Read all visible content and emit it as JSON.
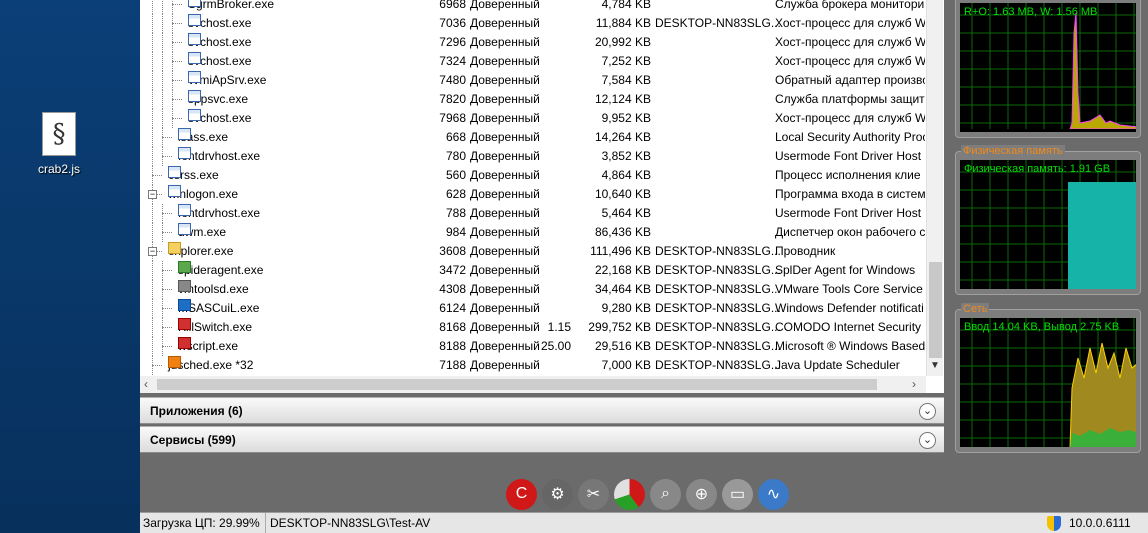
{
  "desktop": {
    "icon_label": "crab2.js"
  },
  "processes": [
    {
      "name": "SgrmBroker.exe",
      "pid": "6968",
      "trust": "Доверенный",
      "cpu": "",
      "mem": "4,784 KB",
      "user": "",
      "desc": "Служба брокера монитори",
      "indent": 4,
      "icon": "window"
    },
    {
      "name": "svchost.exe",
      "pid": "7036",
      "trust": "Доверенный",
      "cpu": "",
      "mem": "11,884 KB",
      "user": "DESKTOP-NN83SLG...",
      "desc": "Хост-процесс для служб W",
      "indent": 4,
      "icon": "window"
    },
    {
      "name": "svchost.exe",
      "pid": "7296",
      "trust": "Доверенный",
      "cpu": "",
      "mem": "20,992 KB",
      "user": "",
      "desc": "Хост-процесс для служб W",
      "indent": 4,
      "icon": "window"
    },
    {
      "name": "svchost.exe",
      "pid": "7324",
      "trust": "Доверенный",
      "cpu": "",
      "mem": "7,252 KB",
      "user": "",
      "desc": "Хост-процесс для служб W",
      "indent": 4,
      "icon": "window"
    },
    {
      "name": "WmiApSrv.exe",
      "pid": "7480",
      "trust": "Доверенный",
      "cpu": "",
      "mem": "7,584 KB",
      "user": "",
      "desc": "Обратный адаптер произво",
      "indent": 4,
      "icon": "window"
    },
    {
      "name": "sppsvc.exe",
      "pid": "7820",
      "trust": "Доверенный",
      "cpu": "",
      "mem": "12,124 KB",
      "user": "",
      "desc": "Служба платформы защит",
      "indent": 4,
      "icon": "window"
    },
    {
      "name": "svchost.exe",
      "pid": "7968",
      "trust": "Доверенный",
      "cpu": "",
      "mem": "9,952 KB",
      "user": "",
      "desc": "Хост-процесс для служб W",
      "indent": 4,
      "icon": "window"
    },
    {
      "name": "lsass.exe",
      "pid": "668",
      "trust": "Доверенный",
      "cpu": "",
      "mem": "14,264 KB",
      "user": "",
      "desc": "Local Security Authority Proc",
      "indent": 3,
      "icon": "window"
    },
    {
      "name": "fontdrvhost.exe",
      "pid": "780",
      "trust": "Доверенный",
      "cpu": "",
      "mem": "3,852 KB",
      "user": "",
      "desc": "Usermode Font Driver Host",
      "indent": 3,
      "icon": "window"
    },
    {
      "name": "csrss.exe",
      "pid": "560",
      "trust": "Доверенный",
      "cpu": "",
      "mem": "4,864 KB",
      "user": "",
      "desc": "Процесс исполнения клие",
      "indent": 2,
      "icon": "window"
    },
    {
      "name": "winlogon.exe",
      "pid": "628",
      "trust": "Доверенный",
      "cpu": "",
      "mem": "10,640 KB",
      "user": "",
      "desc": "Программа входа в систем",
      "indent": 2,
      "icon": "window",
      "expander": "−"
    },
    {
      "name": "fontdrvhost.exe",
      "pid": "788",
      "trust": "Доверенный",
      "cpu": "",
      "mem": "5,464 KB",
      "user": "",
      "desc": "Usermode Font Driver Host",
      "indent": 3,
      "icon": "window"
    },
    {
      "name": "dwm.exe",
      "pid": "984",
      "trust": "Доверенный",
      "cpu": "",
      "mem": "86,436 KB",
      "user": "",
      "desc": "Диспетчер окон рабочего с",
      "indent": 3,
      "icon": "window"
    },
    {
      "name": "explorer.exe",
      "pid": "3608",
      "trust": "Доверенный",
      "cpu": "",
      "mem": "111,496 KB",
      "user": "DESKTOP-NN83SLG...",
      "desc": "Проводник",
      "indent": 2,
      "icon": "folder",
      "expander": "−"
    },
    {
      "name": "spideragent.exe",
      "pid": "3472",
      "trust": "Доверенный",
      "cpu": "",
      "mem": "22,168 KB",
      "user": "DESKTOP-NN83SLG...",
      "desc": "SplDer Agent for Windows",
      "indent": 3,
      "icon": "green"
    },
    {
      "name": "vmtoolsd.exe",
      "pid": "4308",
      "trust": "Доверенный",
      "cpu": "",
      "mem": "34,464 KB",
      "user": "DESKTOP-NN83SLG...",
      "desc": "VMware Tools Core Service",
      "indent": 3,
      "icon": "gray"
    },
    {
      "name": "MSASCuiL.exe",
      "pid": "6124",
      "trust": "Доверенный",
      "cpu": "",
      "mem": "9,280 KB",
      "user": "DESKTOP-NN83SLG...",
      "desc": "Windows Defender notificati",
      "indent": 3,
      "icon": "blue"
    },
    {
      "name": "KillSwitch.exe",
      "pid": "8168",
      "trust": "Доверенный",
      "cpu": "1.15",
      "mem": "299,752 KB",
      "user": "DESKTOP-NN83SLG...",
      "desc": "COMODO Internet Security",
      "indent": 3,
      "icon": "red"
    },
    {
      "name": "wscript.exe",
      "pid": "8188",
      "trust": "Доверенный",
      "cpu": "25.00",
      "mem": "29,516 KB",
      "user": "DESKTOP-NN83SLG...",
      "desc": "Microsoft ® Windows Based",
      "indent": 3,
      "icon": "red"
    },
    {
      "name": "jusched.exe *32",
      "pid": "7188",
      "trust": "Доверенный",
      "cpu": "",
      "mem": "7,000 KB",
      "user": "DESKTOP-NN83SLG...",
      "desc": "Java Update Scheduler",
      "indent": 2,
      "icon": "orange"
    }
  ],
  "sections": {
    "apps": "Приложения (6)",
    "services": "Сервисы (599)"
  },
  "status": {
    "cpu": "Загрузка ЦП: 29.99%",
    "host": "DESKTOP-NN83SLG\\Test-AV",
    "version": "10.0.0.6111"
  },
  "graphs": {
    "disk_label": "R+O: 1.63 MB, W: 1.56 MB",
    "mem_title": "Физическая память",
    "mem_label": "Физическая память: 1.91 GB",
    "net_title": "Сеть",
    "net_label": "Ввод 14.04 KB, Вывод 2.75 KB"
  },
  "toolbar_icons": [
    "comodo-icon",
    "settings-icon",
    "tools-icon",
    "pie-chart-icon",
    "search-icon",
    "magnifier-icon",
    "window-icon",
    "monitor-icon"
  ],
  "colors": {
    "graph_green": "#00e000",
    "mem_fill": "#16b3a8",
    "disk_fill": "#b8a800",
    "net_fill": "#a08a20",
    "accent_orange": "#f08a1c"
  }
}
